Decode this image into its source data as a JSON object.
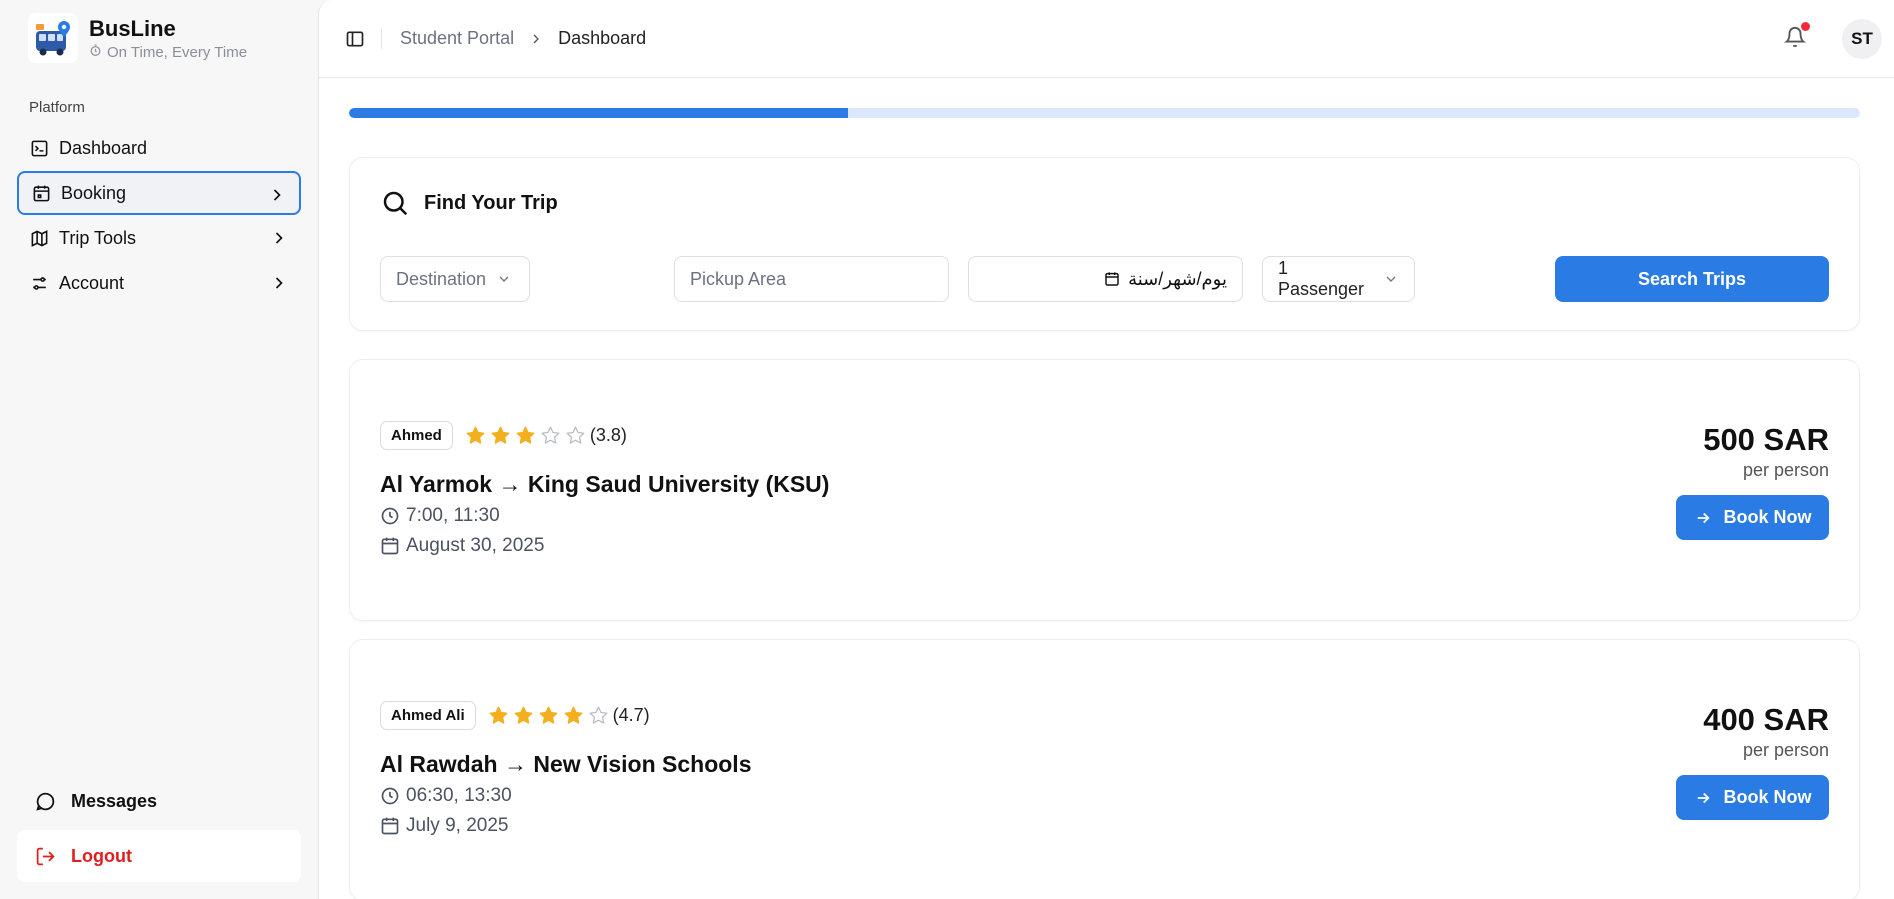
{
  "brand": {
    "name": "BusLine",
    "tagline": "On Time, Every Time"
  },
  "sidebar": {
    "section_label": "Platform",
    "items": [
      {
        "label": "Dashboard",
        "icon": "terminal-icon"
      },
      {
        "label": "Booking",
        "icon": "calendar-icon",
        "active": true
      },
      {
        "label": "Trip Tools",
        "icon": "map-icon"
      },
      {
        "label": "Account",
        "icon": "sliders-icon"
      }
    ],
    "messages_label": "Messages",
    "logout_label": "Logout"
  },
  "header": {
    "breadcrumb_parent": "Student Portal",
    "breadcrumb_current": "Dashboard",
    "avatar_initials": "ST"
  },
  "progress": {
    "value": 0.33
  },
  "search": {
    "title": "Find Your Trip",
    "destination_placeholder": "Destination",
    "pickup_placeholder": "Pickup Area",
    "date_value": "يوم/شهر/سنة",
    "passengers_value": "1 Passenger",
    "button_label": "Search Trips"
  },
  "trips": [
    {
      "driver": "Ahmed",
      "rating": 3.8,
      "rating_label": "(3.8)",
      "stars_filled": 3,
      "route": "Al Yarmok → King Saud University (KSU)",
      "times": "7:00, 11:30",
      "date": "August 30, 2025",
      "price": "500 SAR",
      "price_unit": "per person",
      "button_label": "Book Now"
    },
    {
      "driver": "Ahmed Ali",
      "rating": 4.7,
      "rating_label": "(4.7)",
      "stars_filled": 4,
      "route": "Al Rawdah → New Vision Schools",
      "times": "06:30, 13:30",
      "date": "July 9, 2025",
      "price": "400 SAR",
      "price_unit": "per person",
      "button_label": "Book Now"
    }
  ],
  "colors": {
    "accent": "#2b7be5",
    "star": "#f2b01e",
    "danger": "#e01e1e"
  }
}
